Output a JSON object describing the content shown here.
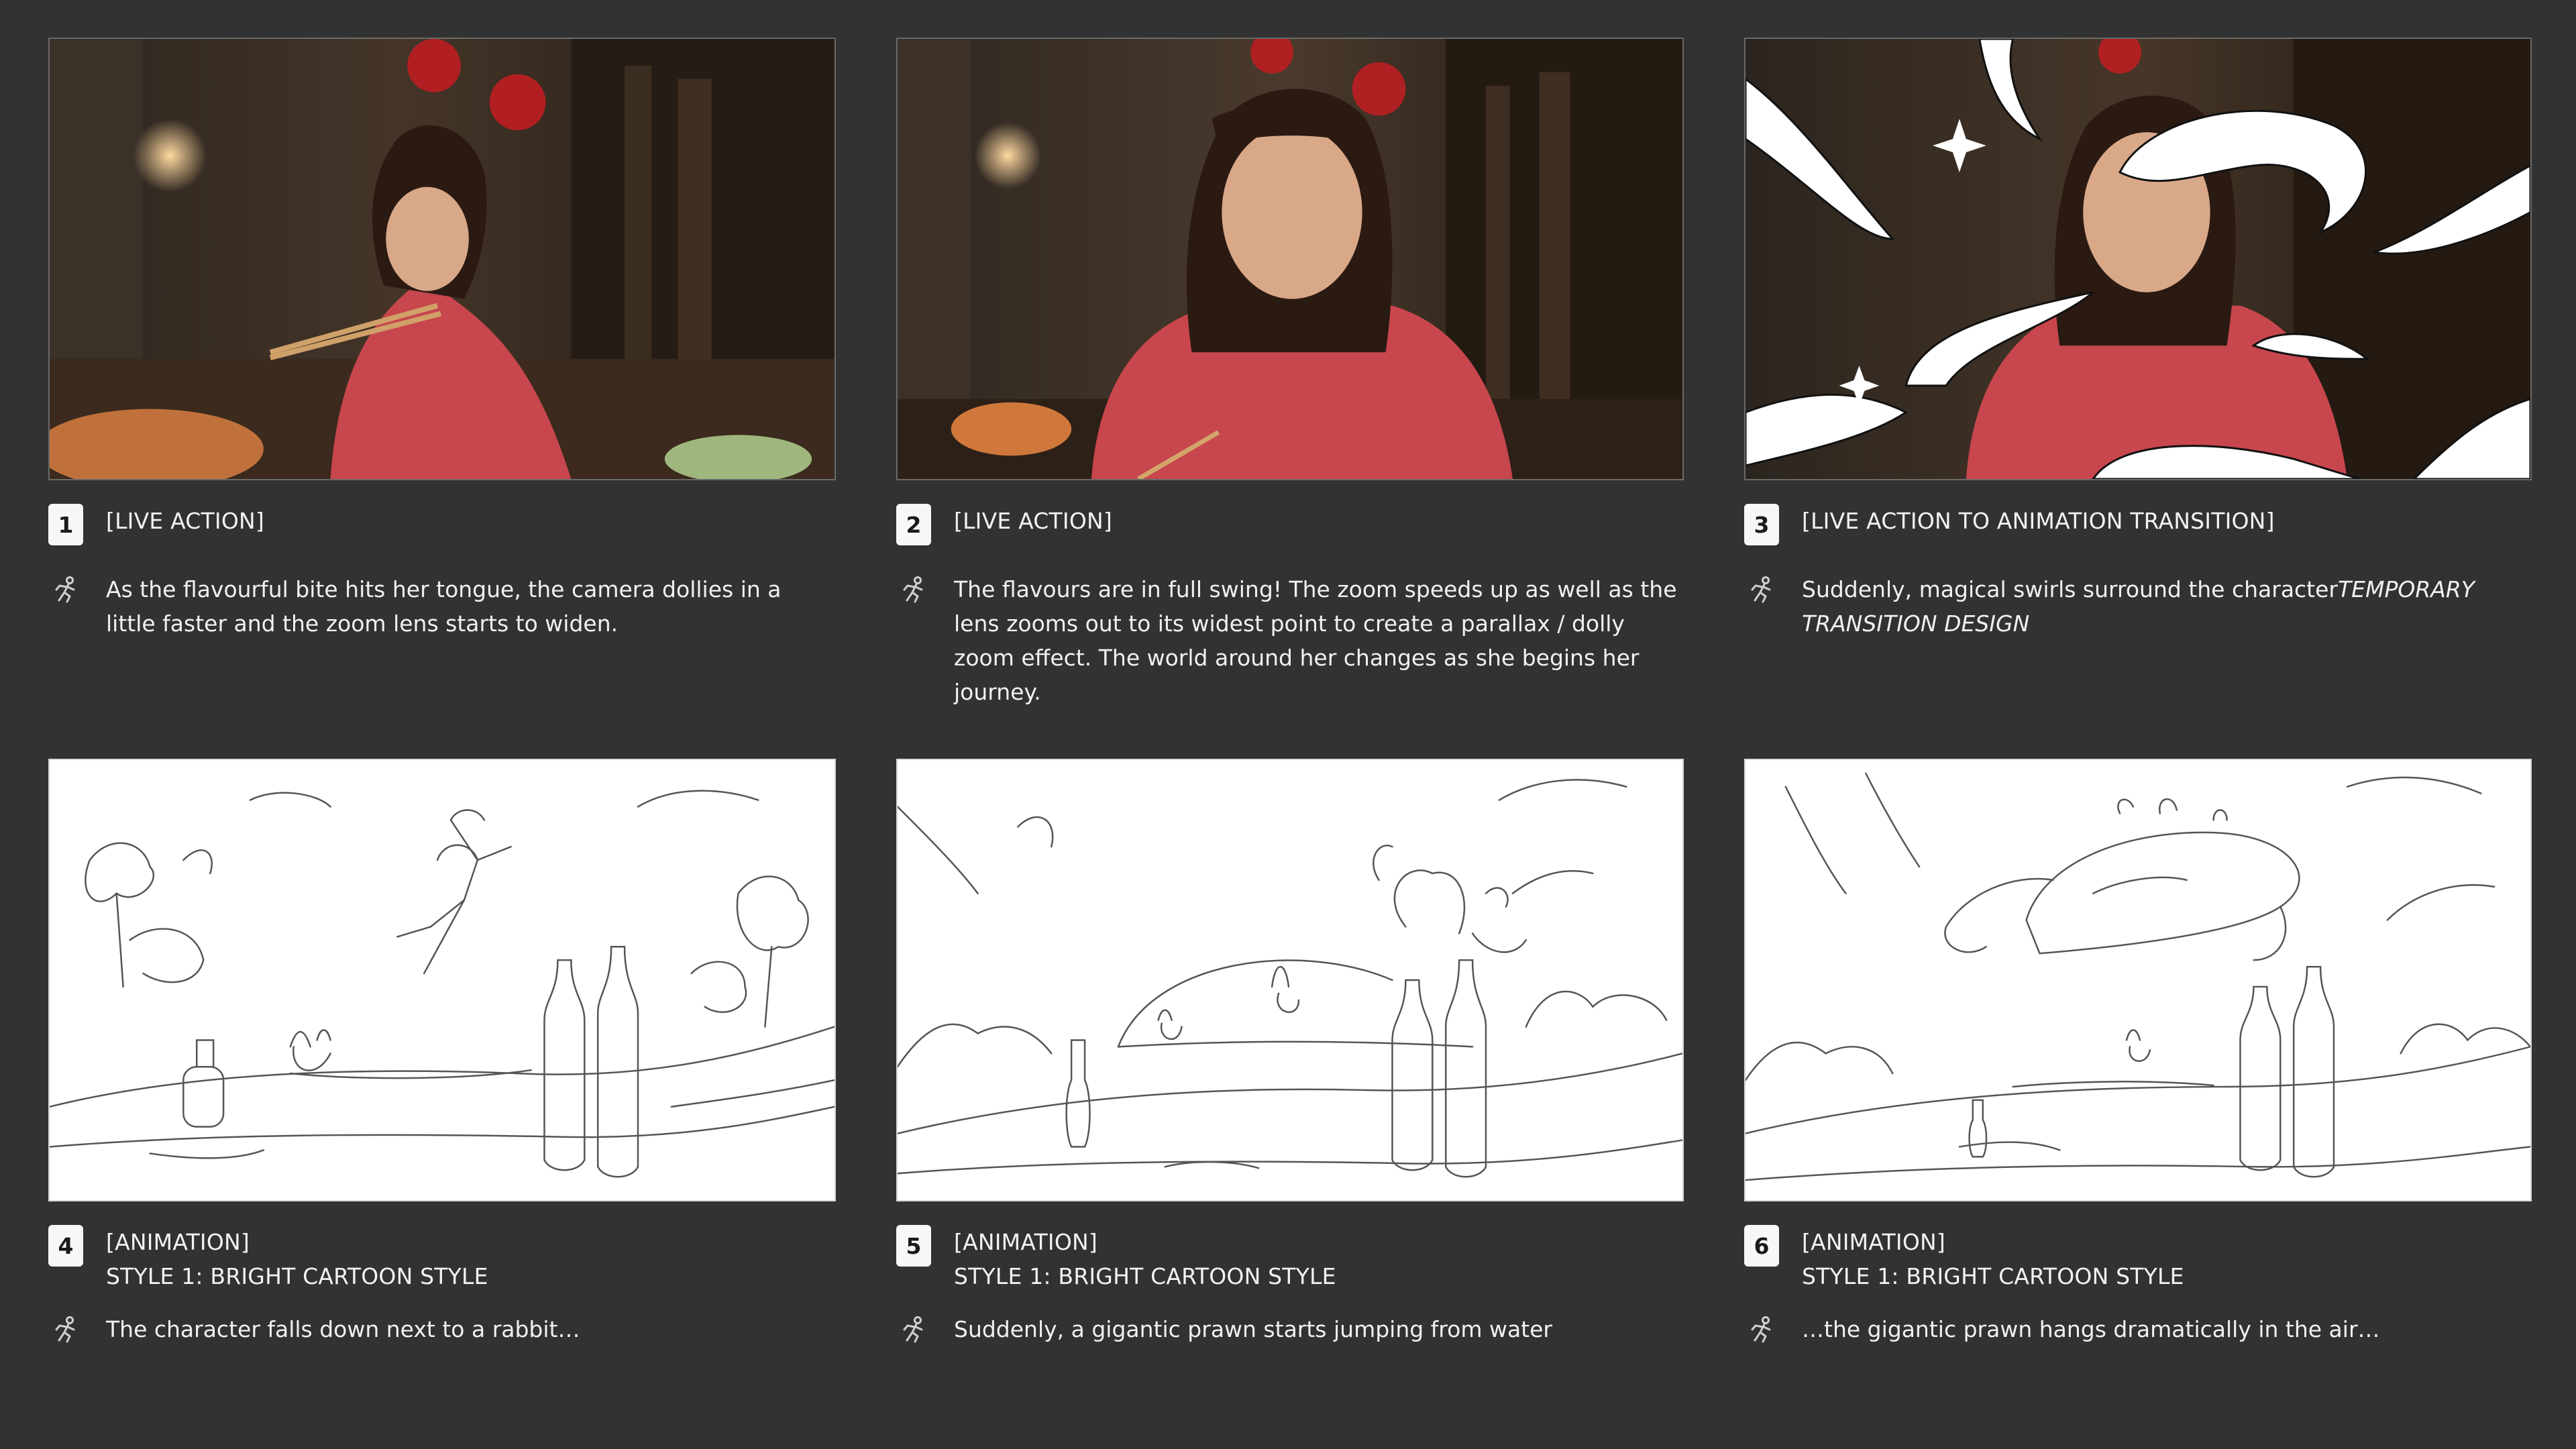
{
  "frames": [
    {
      "number": "1",
      "shot_type": "[LIVE ACTION]",
      "description": "As the flavourful bite hits her tongue, the camera dollies in a little faster and the zoom lens starts to widen.",
      "image": "live-action-woman-eating-with-chopsticks"
    },
    {
      "number": "2",
      "shot_type": "[LIVE ACTION]",
      "description": "The flavours are in full swing! The zoom speeds up as well as the lens zooms out to its widest point to create a parallax / dolly zoom effect. The world around her changes as she begins her journey.",
      "image": "live-action-woman-looking-at-camera"
    },
    {
      "number": "3",
      "shot_type": "[LIVE ACTION TO ANIMATION TRANSITION]",
      "description": "Suddenly, magical swirls surround the character",
      "description_emphasis": "TEMPORARY TRANSITION DESIGN",
      "image": "woman-surrounded-by-white-swirls"
    },
    {
      "number": "4",
      "shot_type": "[ANIMATION]",
      "style": "STYLE 1: BRIGHT CARTOON STYLE",
      "description": "The character falls down next to a rabbit…",
      "image": "sketch-character-falling-next-to-rabbit"
    },
    {
      "number": "5",
      "shot_type": "[ANIMATION]",
      "style": "STYLE 1: BRIGHT CARTOON STYLE",
      "description": "Suddenly, a gigantic prawn starts jumping from water",
      "image": "sketch-prawn-jumping-from-water"
    },
    {
      "number": "6",
      "shot_type": "[ANIMATION]",
      "style": "STYLE 1: BRIGHT CARTOON STYLE",
      "description": "…the gigantic prawn hangs dramatically in the air…",
      "image": "sketch-prawn-in-the-air"
    }
  ],
  "icons": {
    "action": "running-figure-icon"
  },
  "colors": {
    "background": "#323232",
    "text": "#f2f2f2",
    "badge": "#f7f7f7"
  }
}
